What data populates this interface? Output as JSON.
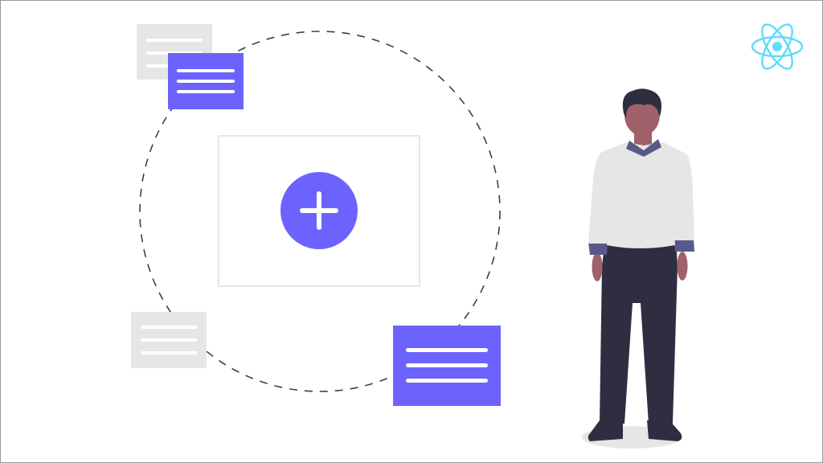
{
  "colors": {
    "accent": "#6c63ff",
    "card_gray": "#e6e6e6",
    "frame_border": "#e6e6e6",
    "dashed_ring": "#3f3d56",
    "react_logo": "#61dafb",
    "skin": "#a0616a",
    "hair": "#2f2e41",
    "shirt": "#dcdcdc",
    "collar": "#575a89",
    "trousers": "#2f2e41",
    "shadow": "#e6e6e6"
  },
  "icons": {
    "add": "plus-icon",
    "logo": "react-logo-icon"
  },
  "main": {
    "add_button_label": "+"
  },
  "cards": [
    {
      "name": "gray-card-top-left",
      "style": "gray"
    },
    {
      "name": "purple-card-top-left",
      "style": "accent"
    },
    {
      "name": "gray-card-bottom-left",
      "style": "gray"
    },
    {
      "name": "purple-card-bottom-right",
      "style": "accent"
    }
  ]
}
